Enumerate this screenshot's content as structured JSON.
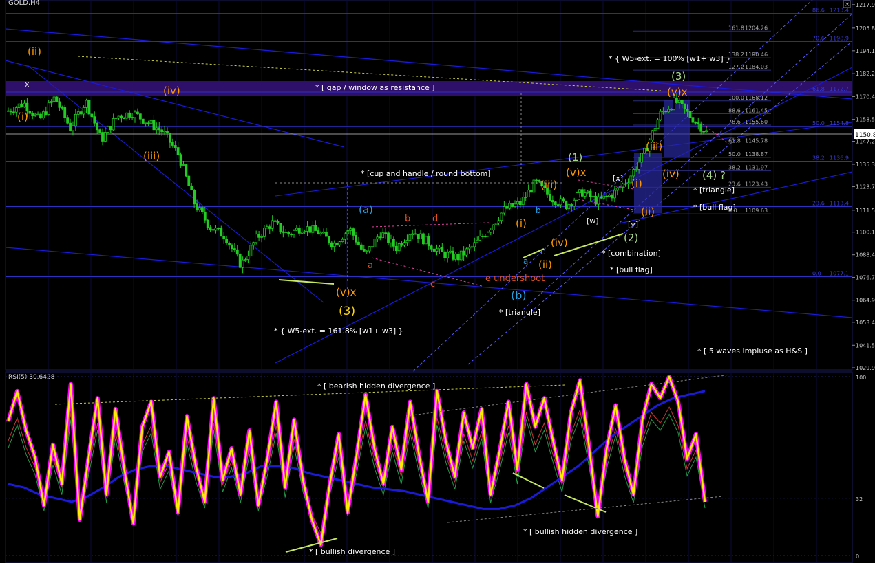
{
  "window": {
    "symbol": "GOLD,H4",
    "close_icon": "close-icon"
  },
  "colors": {
    "background": "#000000",
    "grid": "#0a0a3a",
    "candle": "#22cc22",
    "wave_orange": "#ff9900",
    "wave_blue": "#2a9fe0",
    "wave_yellow": "#ffd800",
    "wave_green": "#a8d88c",
    "channel": "#1a1ad8",
    "gap_zone": "#2e0f6a",
    "rsi_main": "#ffee00",
    "rsi_glow": "#ff00ff",
    "rsi_ma": "#1a1ad8",
    "fib": "#3030c0"
  },
  "chart_data": [
    {
      "type": "candlestick",
      "title": "GOLD,H4",
      "ylim": [
        1029.9,
        1217.9
      ],
      "price_axis_ticks": [
        "1217.95",
        "1205.85",
        "1194.10",
        "1182.25",
        "1170.40",
        "1158.55",
        "1147.20",
        "1135.30",
        "1123.70",
        "1111.50",
        "1100.15",
        "1088.40",
        "1076.75",
        "1064.90",
        "1053.45",
        "1041.55",
        "1029.90"
      ],
      "current_price": "1150.84",
      "close_path_hint": [
        1163,
        1167,
        1158,
        1170,
        1154,
        1168,
        1148,
        1160,
        1162,
        1157,
        1152,
        1140,
        1115,
        1103,
        1098,
        1083,
        1097,
        1105,
        1099,
        1103,
        1100,
        1094,
        1102,
        1088,
        1100,
        1092,
        1101,
        1095,
        1089,
        1087,
        1093,
        1102,
        1112,
        1115,
        1126,
        1118,
        1114,
        1121,
        1116,
        1120,
        1128,
        1141,
        1161,
        1168,
        1160,
        1152
      ],
      "fib_right": [
        {
          "ratio": "161.8",
          "value": "1204.26"
        },
        {
          "ratio": "138.2",
          "value": "1190.46"
        },
        {
          "ratio": "127.2",
          "value": "1184.03"
        },
        {
          "ratio": "100.0",
          "value": "1168.12"
        },
        {
          "ratio": "88.6",
          "value": "1161.45"
        },
        {
          "ratio": "78.6",
          "value": "1155.60"
        },
        {
          "ratio": "61.8",
          "value": "1145.78"
        },
        {
          "ratio": "50.0",
          "value": "1138.87"
        },
        {
          "ratio": "38.2",
          "value": "1131.97"
        },
        {
          "ratio": "23.6",
          "value": "1123.43"
        },
        {
          "ratio": "0.0",
          "value": "1109.63"
        }
      ],
      "fib_main": [
        {
          "ratio": "86.6",
          "value": "1213.4"
        },
        {
          "ratio": "70.6",
          "value": "1198.9"
        },
        {
          "ratio": "61.8",
          "value": "1172.7"
        },
        {
          "ratio": "50.0",
          "value": "1154.8"
        },
        {
          "ratio": "38.2",
          "value": "1136.9"
        },
        {
          "ratio": "23.6",
          "value": "1113.4"
        },
        {
          "ratio": "0.0",
          "value": "1077.1"
        }
      ],
      "wave_labels": [
        {
          "text": "(ii)",
          "color": "orange"
        },
        {
          "text": "x",
          "color": "white"
        },
        {
          "text": "(i)",
          "color": "orange"
        },
        {
          "text": "(iv)",
          "color": "orange"
        },
        {
          "text": "(iii)",
          "color": "orange"
        },
        {
          "text": "(v)x",
          "color": "orange"
        },
        {
          "text": "(3)",
          "color": "yellow"
        },
        {
          "text": "(a)",
          "color": "blue"
        },
        {
          "text": "a",
          "color": "red"
        },
        {
          "text": "b",
          "color": "red"
        },
        {
          "text": "c",
          "color": "red"
        },
        {
          "text": "d",
          "color": "red"
        },
        {
          "text": "e undershoot",
          "color": "red"
        },
        {
          "text": "(b)",
          "color": "blue"
        },
        {
          "text": "(i)",
          "color": "orange"
        },
        {
          "text": "a",
          "color": "blue"
        },
        {
          "text": "b",
          "color": "blue"
        },
        {
          "text": "c",
          "color": "blue"
        },
        {
          "text": "(ii)",
          "color": "orange"
        },
        {
          "text": "(iv)",
          "color": "orange"
        },
        {
          "text": "(iii)",
          "color": "orange"
        },
        {
          "text": "(1)",
          "color": "green"
        },
        {
          "text": "(v)x",
          "color": "orange"
        },
        {
          "text": "[x]",
          "color": "white"
        },
        {
          "text": "[w]",
          "color": "white"
        },
        {
          "text": "[y]",
          "color": "white"
        },
        {
          "text": "(2)",
          "color": "green"
        },
        {
          "text": "(i)",
          "color": "orange"
        },
        {
          "text": "(ii)",
          "color": "orange"
        },
        {
          "text": "(iii)",
          "color": "orange"
        },
        {
          "text": "(iv)",
          "color": "orange"
        },
        {
          "text": "(3)",
          "color": "green"
        },
        {
          "text": "(v)x",
          "color": "orange"
        },
        {
          "text": "(4) ?",
          "color": "green"
        }
      ],
      "annotations": [
        "* [ gap / window as resistance ]",
        "* [cup and handle / round bottom]",
        "* { W5-ext. = 100% [w1+ w3] }",
        "* { W5-ext. = 161.8% [w1+ w3] }",
        "* [triangle]",
        "* [combination]",
        "* [bull flag]",
        "* [triangle]",
        "* [bull flag]",
        "* [ 5 waves impluse as H&S ]"
      ]
    },
    {
      "type": "line",
      "title": "RSI(5) 30.6428",
      "ylim": [
        0,
        100
      ],
      "axis_ticks": [
        "100",
        "32",
        "0"
      ],
      "series": [
        {
          "name": "RSI(5)",
          "values": [
            75,
            92,
            70,
            55,
            28,
            62,
            40,
            96,
            20,
            55,
            88,
            34,
            82,
            48,
            18,
            72,
            86,
            44,
            58,
            24,
            78,
            50,
            30,
            88,
            42,
            60,
            34,
            70,
            28,
            54,
            86,
            38,
            76,
            42,
            20,
            6,
            40,
            68,
            24,
            56,
            90,
            60,
            40,
            72,
            48,
            86,
            56,
            30,
            92,
            64,
            44,
            80,
            60,
            82,
            34,
            58,
            86,
            48,
            96,
            72,
            88,
            64,
            42,
            80,
            98,
            62,
            22,
            60,
            84,
            54,
            34,
            76,
            96,
            88,
            100,
            86,
            54,
            68,
            30
          ]
        },
        {
          "name": "RSI MA",
          "values": [
            40,
            38,
            34,
            32,
            30,
            33,
            38,
            44,
            48,
            50,
            50,
            48,
            46,
            44,
            44,
            46,
            50,
            50,
            49,
            46,
            44,
            42,
            40,
            38,
            37,
            36,
            34,
            32,
            30,
            28,
            26,
            26,
            28,
            32,
            38,
            44,
            50,
            58,
            66,
            72,
            78,
            84,
            88,
            90,
            92
          ]
        }
      ],
      "annotations": [
        "* [ bearish hidden divergence ]",
        "* [ bullish hidden divergence ]",
        "* [ bullish divergence ]"
      ]
    }
  ]
}
